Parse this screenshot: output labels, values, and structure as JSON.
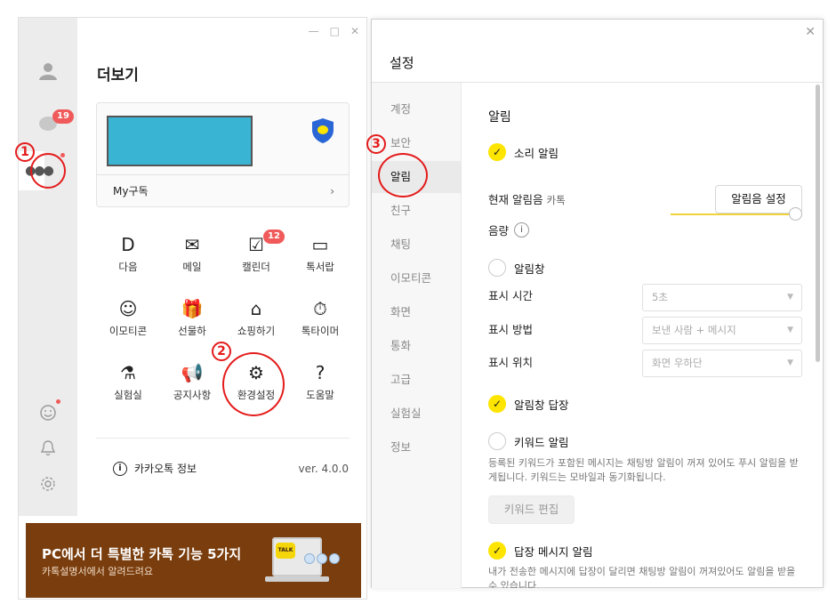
{
  "left": {
    "title": "더보기",
    "chat_badge": "19",
    "card_footer": "My구독",
    "grid": [
      {
        "icon": "D",
        "label": "다음",
        "name": "daum"
      },
      {
        "icon": "✉",
        "label": "메일",
        "name": "mail"
      },
      {
        "icon": "☑",
        "label": "캘린더",
        "name": "calendar",
        "badge": "12"
      },
      {
        "icon": "▭",
        "label": "톡서랍",
        "name": "talk-drawer"
      },
      {
        "icon": "☺",
        "label": "이모티콘",
        "name": "emoticon"
      },
      {
        "icon": "🎁",
        "label": "선물하",
        "name": "gift"
      },
      {
        "icon": "⌂",
        "label": "쇼핑하기",
        "name": "shopping"
      },
      {
        "icon": "⏱",
        "label": "톡타이머",
        "name": "talk-timer"
      },
      {
        "icon": "⚗",
        "label": "실험실",
        "name": "lab"
      },
      {
        "icon": "📢",
        "label": "공지사항",
        "name": "notice"
      },
      {
        "icon": "⚙",
        "label": "환경설정",
        "name": "settings"
      },
      {
        "icon": "?",
        "label": "도움말",
        "name": "help"
      }
    ],
    "info_label": "카카오톡 정보",
    "version": "ver. 4.0.0",
    "promo_title": "PC에서 더 특별한 카톡 기능 5가지",
    "promo_sub": "카톡설명서에서 알려드려요",
    "promo_logo": "TALK"
  },
  "annotations": [
    "1",
    "2",
    "3"
  ],
  "settings": {
    "title": "설정",
    "nav": [
      "계정",
      "보안",
      "알림",
      "친구",
      "채팅",
      "이모티콘",
      "화면",
      "통화",
      "고급",
      "실험실",
      "정보"
    ],
    "active_index": 2,
    "section_title": "알림",
    "sound_alert": "소리 알림",
    "current_sound_label": "현재 알림음",
    "current_sound_value": "카톡",
    "sound_button": "알림음 설정",
    "volume_label": "음량",
    "popup_label": "알림창",
    "display_time_label": "표시 시간",
    "display_time_value": "5초",
    "display_method_label": "표시 방법",
    "display_method_value": "보낸 사람 + 메시지",
    "display_position_label": "표시 위치",
    "display_position_value": "화면 우하단",
    "popup_reply": "알림창 답장",
    "keyword_alert": "키워드 알림",
    "keyword_desc": "등록된 키워드가 포함된 메시지는 채팅방 알림이 꺼져 있어도 푸시 알림을 받게됩니다. 키워드는 모바일과 동기화됩니다.",
    "keyword_button": "키워드 편집",
    "reply_alert": "답장 메시지 알림",
    "reply_desc": "내가 전송한 메시지에 답장이 달리면 채팅방 알림이 꺼져있어도 알림을 받을 수 있습니다."
  }
}
